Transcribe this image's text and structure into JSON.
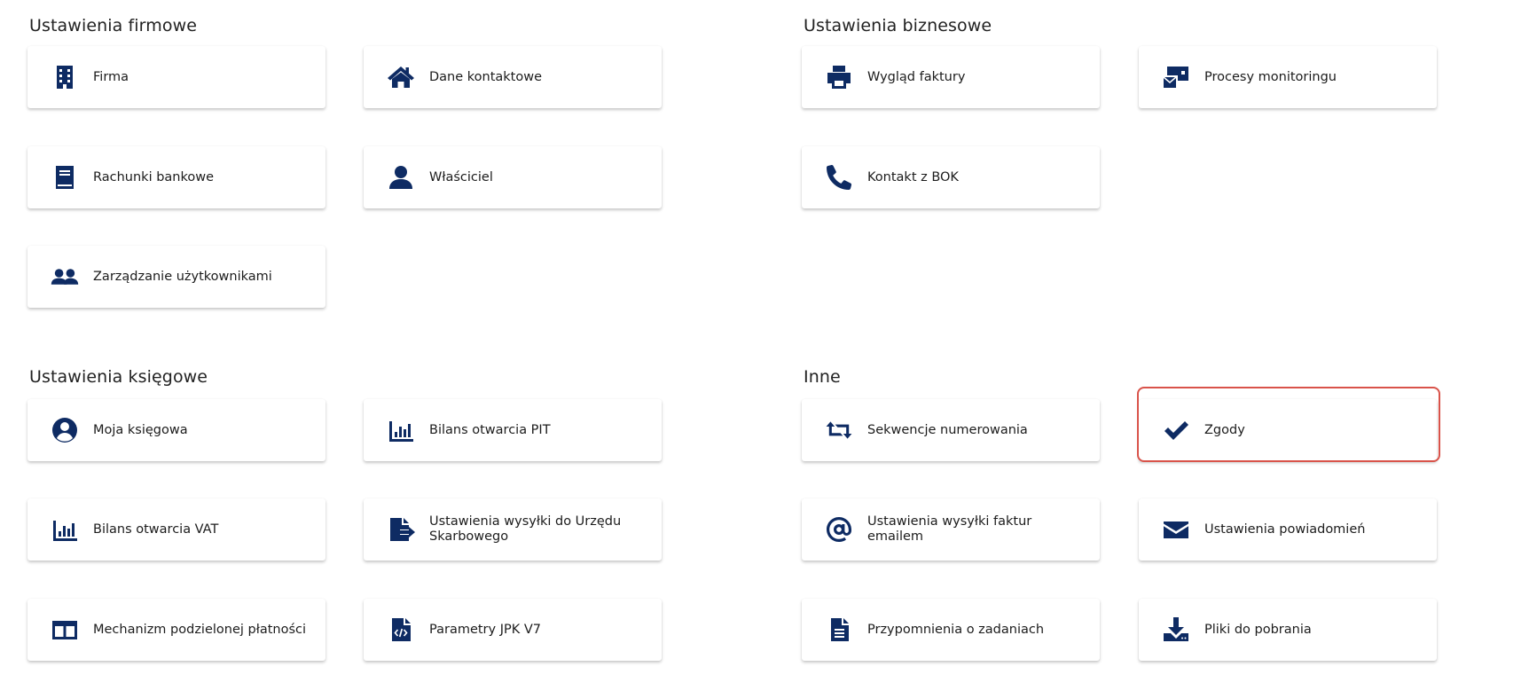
{
  "sections": {
    "firmowe": "Ustawienia firmowe",
    "biznesowe": "Ustawienia biznesowe",
    "ksiegowe": "Ustawienia księgowe",
    "inne": "Inne"
  },
  "tiles": {
    "firma": {
      "label": "Firma",
      "icon": "building-icon"
    },
    "dane_kontaktowe": {
      "label": "Dane kontaktowe",
      "icon": "home-icon"
    },
    "rachunki_bankowe": {
      "label": "Rachunki bankowe",
      "icon": "book-icon"
    },
    "wlasciciel": {
      "label": "Właściciel",
      "icon": "user-icon"
    },
    "zarzadzanie_uzytkownikami": {
      "label": "Zarządzanie użytkownikami",
      "icon": "users-icon"
    },
    "wyglad_faktury": {
      "label": "Wygląd faktury",
      "icon": "printer-icon"
    },
    "procesy_monitoringu": {
      "label": "Procesy monitoringu",
      "icon": "monitoring-icon"
    },
    "kontakt_bok": {
      "label": "Kontakt z BOK",
      "icon": "phone-icon"
    },
    "moja_ksiegowa": {
      "label": "Moja księgowa",
      "icon": "user-circle-icon"
    },
    "bilans_pit": {
      "label": "Bilans otwarcia PIT",
      "icon": "bar-chart-icon"
    },
    "bilans_vat": {
      "label": "Bilans otwarcia VAT",
      "icon": "bar-chart-icon"
    },
    "wysylka_us": {
      "label": "Ustawienia wysyłki do Urzędu Skarbowego",
      "icon": "file-export-icon"
    },
    "mechanizm": {
      "label": "Mechanizm podzielonej płatności",
      "icon": "columns-icon"
    },
    "jpk": {
      "label": "Parametry JPK V7",
      "icon": "file-code-icon"
    },
    "sekwencje": {
      "label": "Sekwencje numerowania",
      "icon": "retweet-icon"
    },
    "zgody": {
      "label": "Zgody",
      "icon": "check-icon"
    },
    "wysylka_email": {
      "label": "Ustawienia wysyłki faktur emailem",
      "icon": "at-icon"
    },
    "powiadomienia": {
      "label": "Ustawienia powiadomień",
      "icon": "envelope-icon"
    },
    "przypomnienia": {
      "label": "Przypomnienia o zadaniach",
      "icon": "file-text-icon"
    },
    "pliki": {
      "label": "Pliki do pobrania",
      "icon": "download-icon"
    }
  },
  "colors": {
    "icon": "#0e2b63",
    "highlight": "#d9534a"
  }
}
